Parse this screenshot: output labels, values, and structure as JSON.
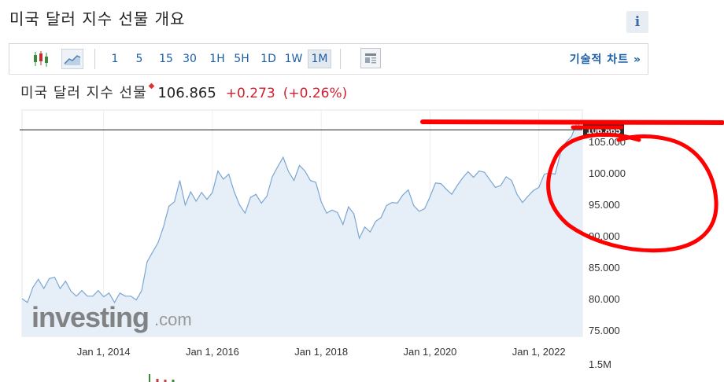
{
  "page": {
    "title": "미국 달러 지수 선물 개요",
    "info_label": "i"
  },
  "toolbar": {
    "intervals": [
      "1",
      "5",
      "15",
      "30",
      "1H",
      "5H",
      "1D",
      "1W",
      "1M"
    ],
    "active_interval": "1M",
    "tech_chart_link": "기술적 차트 »",
    "icons": [
      "candlestick-icon",
      "area-chart-icon",
      "news-icon"
    ]
  },
  "quote": {
    "name": "미국 달러 지수 선물",
    "price": "106.865",
    "change": "+0.273",
    "change_pct": "(+0.26%)",
    "color_down": "#d01f2f"
  },
  "watermark": "investing.com",
  "colors": {
    "area_fill": "#e6eef7",
    "line": "#7aa6d2",
    "annotation": "#ff0000",
    "link": "#1b5fa8"
  },
  "chart_data": {
    "type": "area",
    "x_tick_labels": [
      "Jan 1, 2014",
      "Jan 1, 2016",
      "Jan 1, 2018",
      "Jan 1, 2020",
      "Jan 1, 2022"
    ],
    "y_tick_labels": [
      "105.000",
      "100.000",
      "95.000",
      "90.000",
      "85.000",
      "80.000",
      "75.000"
    ],
    "ylim": [
      74,
      110
    ],
    "volume_label": "1.5M",
    "current_value_label": "106.865",
    "current_value": 106.865,
    "x_start_year": 2012.5,
    "x_end_year": 2022.8,
    "series": [
      {
        "x": [
          2012.5,
          2012.6,
          2012.7,
          2012.8,
          2012.9,
          2013.0,
          2013.1,
          2013.2,
          2013.3,
          2013.4,
          2013.5,
          2013.6,
          2013.7,
          2013.8,
          2013.9,
          2014.0,
          2014.1,
          2014.2,
          2014.3,
          2014.4,
          2014.5,
          2014.6,
          2014.7,
          2014.8,
          2014.9,
          2015.0,
          2015.1,
          2015.2,
          2015.3,
          2015.4,
          2015.5,
          2015.6,
          2015.7,
          2015.8,
          2015.9,
          2016.0,
          2016.1,
          2016.2,
          2016.3,
          2016.4,
          2016.5,
          2016.6,
          2016.7,
          2016.8,
          2016.9,
          2017.0,
          2017.1,
          2017.2,
          2017.3,
          2017.4,
          2017.5,
          2017.6,
          2017.7,
          2017.8,
          2017.9,
          2018.0,
          2018.1,
          2018.2,
          2018.3,
          2018.4,
          2018.5,
          2018.6,
          2018.7,
          2018.8,
          2018.9,
          2019.0,
          2019.1,
          2019.2,
          2019.3,
          2019.4,
          2019.5,
          2019.6,
          2019.7,
          2019.8,
          2019.9,
          2020.0,
          2020.1,
          2020.2,
          2020.3,
          2020.4,
          2020.5,
          2020.6,
          2020.7,
          2020.8,
          2020.9,
          2021.0,
          2021.1,
          2021.2,
          2021.3,
          2021.4,
          2021.5,
          2021.6,
          2021.7,
          2021.8,
          2021.9,
          2022.0,
          2022.1,
          2022.2,
          2022.3,
          2022.4,
          2022.5,
          2022.6,
          2022.7,
          2022.8
        ],
        "values": [
          80.0,
          79.4,
          81.8,
          83.1,
          81.6,
          83.2,
          83.4,
          81.6,
          82.8,
          81.2,
          80.4,
          81.3,
          80.4,
          80.4,
          81.3,
          80.3,
          80.9,
          79.4,
          80.9,
          80.4,
          80.4,
          79.8,
          81.3,
          85.9,
          87.4,
          88.9,
          91.4,
          94.7,
          95.4,
          98.8,
          94.9,
          97.0,
          95.5,
          96.9,
          95.8,
          96.9,
          100.3,
          99.0,
          99.8,
          97.0,
          94.9,
          93.6,
          96.1,
          96.6,
          95.2,
          96.3,
          99.4,
          101.0,
          102.5,
          100.2,
          98.8,
          101.2,
          100.3,
          98.8,
          98.5,
          95.4,
          93.6,
          94.1,
          93.7,
          91.8,
          94.6,
          93.5,
          89.6,
          91.4,
          90.6,
          92.3,
          92.9,
          94.8,
          95.3,
          95.2,
          96.5,
          97.3,
          94.8,
          93.9,
          94.3,
          96.2,
          98.4,
          98.3,
          97.4,
          96.6,
          98.0,
          99.2,
          100.2,
          99.3,
          100.3,
          100.1,
          98.9,
          97.7,
          98.0,
          99.4,
          98.8,
          96.6,
          95.3,
          96.3,
          97.2,
          97.7,
          99.8,
          100.0,
          99.8,
          103.2,
          104.9,
          105.8,
          108.0,
          106.9
        ]
      }
    ]
  }
}
